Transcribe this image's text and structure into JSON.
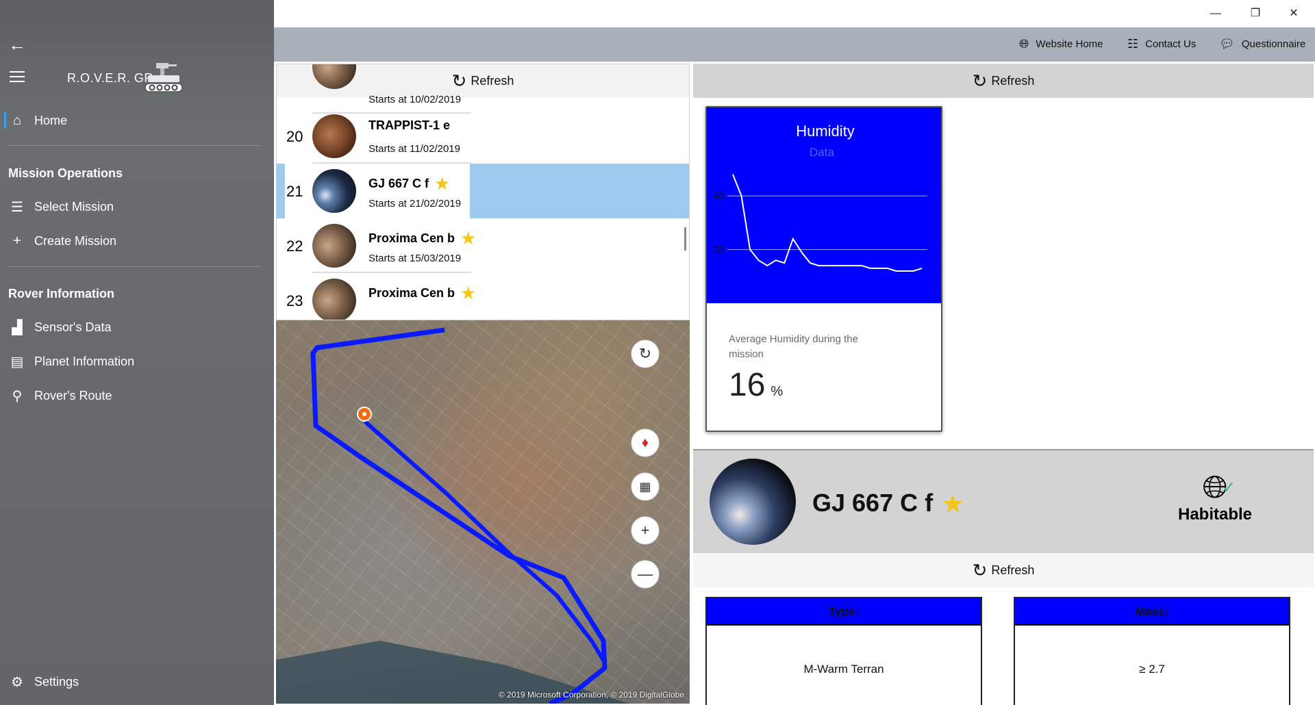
{
  "app": {
    "title": "R.O.V.E.R. GR"
  },
  "sidebar": {
    "home": "Home",
    "sections": [
      {
        "header": "Mission Operations",
        "items": [
          "Select Mission",
          "Create Mission"
        ]
      },
      {
        "header": "Rover Information",
        "items": [
          "Sensor's Data",
          "Planet Information",
          "Rover's Route"
        ]
      }
    ],
    "settings": "Settings"
  },
  "window": {
    "minimize": "—",
    "restore": "❐",
    "close": "✕"
  },
  "topbar": {
    "links": [
      "Website Home",
      "Contact Us",
      "Questionnaire"
    ]
  },
  "common": {
    "refresh_label": "Refresh"
  },
  "missions": [
    {
      "number": "",
      "name": "",
      "start": "Starts at 10/02/2019",
      "favorite": false
    },
    {
      "number": "20",
      "name": "TRAPPIST-1 e",
      "start": "Starts at 11/02/2019",
      "favorite": false
    },
    {
      "number": "21",
      "name": "GJ 667 C f",
      "start": "Starts at 21/02/2019",
      "favorite": true,
      "selected": true
    },
    {
      "number": "22",
      "name": "Proxima Cen b",
      "start": "Starts at 15/03/2019",
      "favorite": true
    },
    {
      "number": "23",
      "name": "Proxima Cen b",
      "start": "",
      "favorite": true
    }
  ],
  "map": {
    "copyright": "© 2019 Microsoft Corporation, © 2019 DigitalGlobe"
  },
  "humidity": {
    "title": "Humidity",
    "subtitle": "Data",
    "label": "Average Humidity during the mission",
    "value": "16",
    "unit": "%",
    "chart_data": {
      "type": "line",
      "title": "Humidity",
      "subtitle": "Data",
      "yticks": [
        "40",
        "20"
      ],
      "ylim": [
        0,
        50
      ],
      "values": [
        48,
        40,
        20,
        16,
        14,
        16,
        15,
        24,
        19,
        15,
        14,
        14,
        14,
        14,
        14,
        14,
        13,
        13,
        13,
        12,
        12,
        12,
        13
      ],
      "grid": true,
      "color": "#ffffff",
      "background": "#0000ff"
    }
  },
  "planet": {
    "name": "GJ 667 C f",
    "favorite": true,
    "status": "Habitable",
    "type_label": "Type:",
    "type_value": "M-Warm Terran",
    "mass_label": "Mass:",
    "mass_value": "≥ 2.7"
  }
}
